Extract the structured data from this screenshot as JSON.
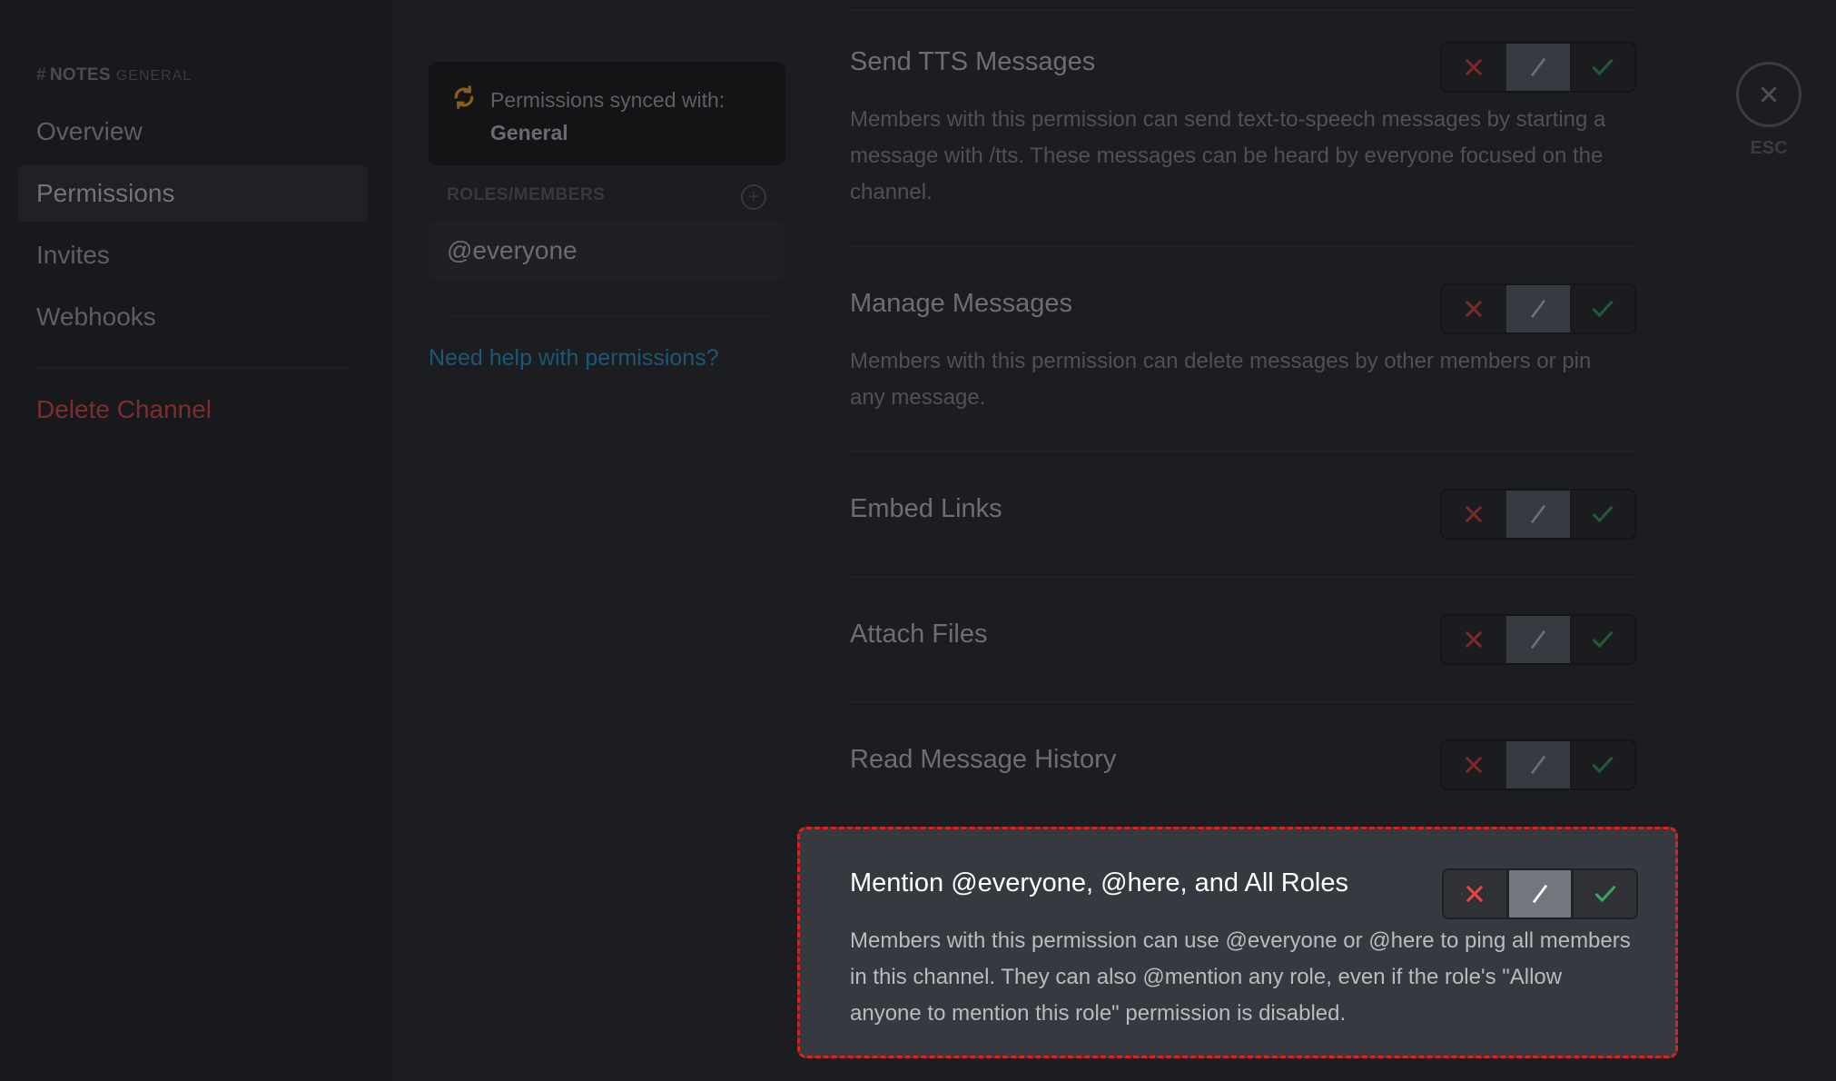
{
  "sidebar": {
    "channel_name": "NOTES",
    "category": "GENERAL",
    "items": [
      {
        "label": "Overview",
        "active": false
      },
      {
        "label": "Permissions",
        "active": true
      },
      {
        "label": "Invites",
        "active": false
      },
      {
        "label": "Webhooks",
        "active": false
      }
    ],
    "delete_label": "Delete Channel"
  },
  "sync": {
    "text": "Permissions synced with:",
    "category": "General"
  },
  "roles": {
    "header": "ROLES/MEMBERS",
    "items": [
      "@everyone"
    ],
    "help_link": "Need help with permissions?"
  },
  "permissions": [
    {
      "title": "Send TTS Messages",
      "description": "Members with this permission can send text-to-speech messages by starting a message with /tts. These messages can be heard by everyone focused on the channel.",
      "state": "neutral"
    },
    {
      "title": "Manage Messages",
      "description": "Members with this permission can delete messages by other members or pin any message.",
      "state": "neutral"
    },
    {
      "title": "Embed Links",
      "description": "",
      "state": "neutral"
    },
    {
      "title": "Attach Files",
      "description": "",
      "state": "neutral"
    },
    {
      "title": "Read Message History",
      "description": "",
      "state": "neutral"
    },
    {
      "title": "Mention @everyone, @here, and All Roles",
      "description": "Members with this permission can use @everyone or @here to ping all members in this channel. They can also @mention any role, even if the role's \"Allow anyone to mention this role\" permission is disabled.",
      "state": "neutral",
      "highlighted": true
    }
  ],
  "toggle_icons": {
    "deny": "x-icon",
    "neutral": "slash-icon",
    "allow": "check-icon"
  },
  "colors": {
    "deny": "#ed4245",
    "allow": "#3ba55c",
    "highlight_border": "#e02020",
    "link": "#00aff4"
  },
  "close": {
    "label": "ESC"
  }
}
